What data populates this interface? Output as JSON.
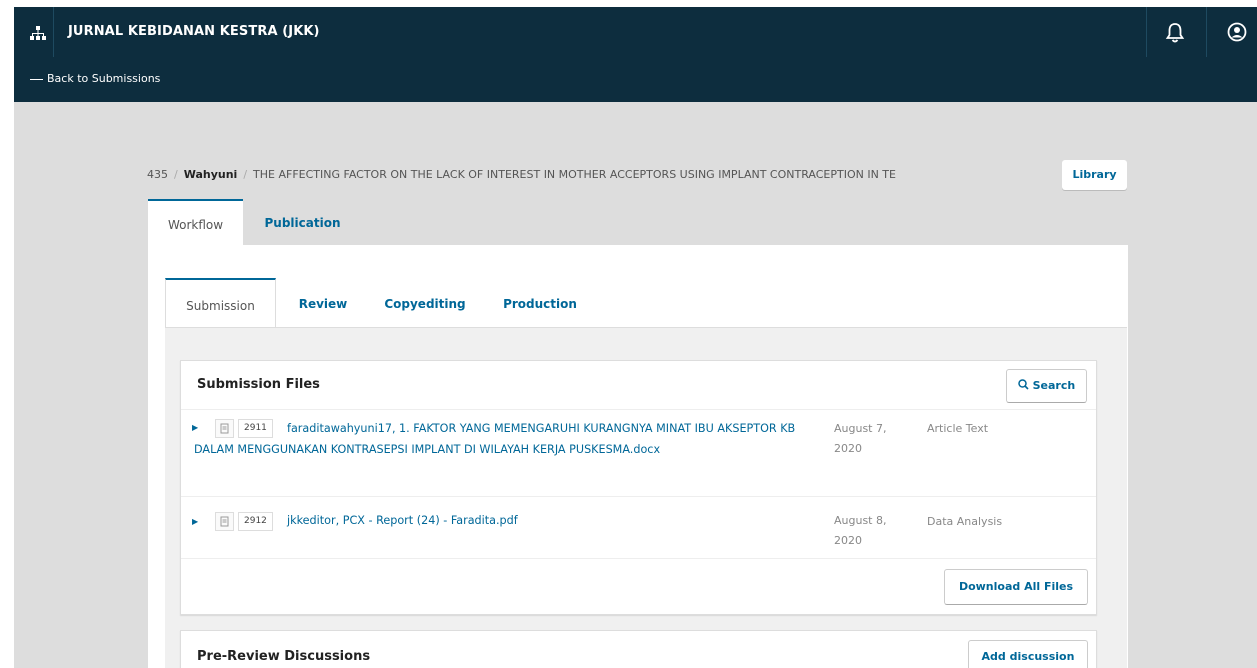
{
  "header": {
    "journal_title": "JURNAL KEBIDANAN KESTRA (JKK)",
    "back_link": "Back to Submissions"
  },
  "breadcrumb": {
    "id": "435",
    "author": "Wahyuni",
    "title": "THE AFFECTING FACTOR ON THE LACK OF INTEREST IN MOTHER ACCEPTORS USING IMPLANT CONTRACEPTION IN TE",
    "library_label": "Library"
  },
  "tabs": [
    {
      "label": "Workflow",
      "active": true
    },
    {
      "label": "Publication",
      "active": false
    }
  ],
  "subtabs": [
    {
      "label": "Submission",
      "active": true
    },
    {
      "label": "Review",
      "active": false
    },
    {
      "label": "Copyediting",
      "active": false
    },
    {
      "label": "Production",
      "active": false
    }
  ],
  "submission_files": {
    "title": "Submission Files",
    "search_label": "Search",
    "download_all_label": "Download All Files",
    "files": [
      {
        "id": "2911",
        "name": "faraditawahyuni17, 1. FAKTOR YANG MEMENGARUHI KURANGNYA MINAT IBU AKSEPTOR KB DALAM MENGGUNAKAN KONTRASEPSI IMPLANT DI WILAYAH KERJA PUSKESMA.docx",
        "date": "August 7, 2020",
        "type": "Article Text"
      },
      {
        "id": "2912",
        "name": "jkkeditor, PCX - Report (24) - Faradita.pdf",
        "date": "August 8, 2020",
        "type": "Data Analysis"
      }
    ]
  },
  "discussions": {
    "title": "Pre-Review Discussions",
    "add_label": "Add discussion"
  },
  "colors": {
    "header_bg": "#0d2d3e",
    "accent": "#006798",
    "page_bg": "#dddddd"
  }
}
